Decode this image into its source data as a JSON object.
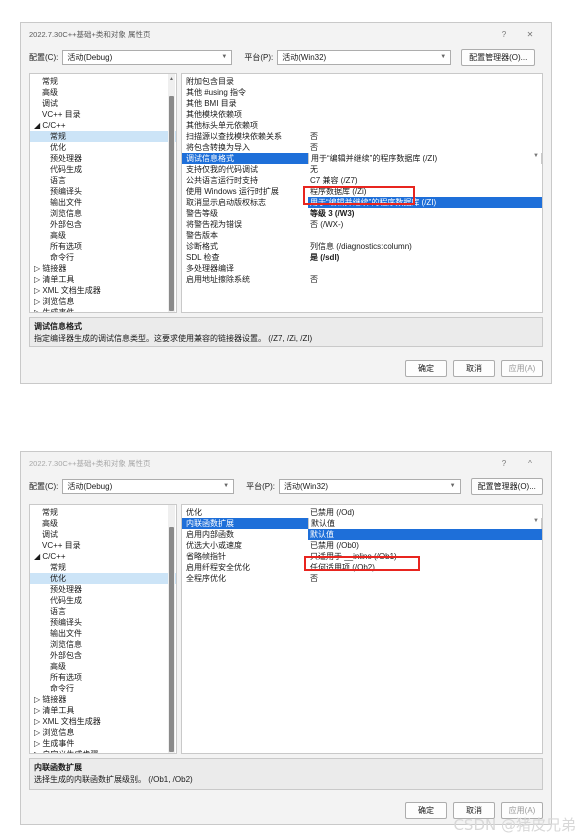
{
  "dialog1": {
    "title": "2022.7.30C++基础+类和对象 属性页",
    "help_glyph": "?",
    "close_glyph": "✕",
    "config_label": "配置(C):",
    "config_value": "活动(Debug)",
    "platform_label": "平台(P):",
    "platform_value": "活动(Win32)",
    "config_manager": "配置管理器(O)...",
    "tree": [
      {
        "label": "常规",
        "indent": 1
      },
      {
        "label": "高级",
        "indent": 1
      },
      {
        "label": "调试",
        "indent": 1
      },
      {
        "label": "VC++ 目录",
        "indent": 1
      },
      {
        "label": "◢ C/C++",
        "indent": 0
      },
      {
        "label": "常规",
        "indent": 2,
        "selected": true
      },
      {
        "label": "优化",
        "indent": 2
      },
      {
        "label": "预处理器",
        "indent": 2
      },
      {
        "label": "代码生成",
        "indent": 2
      },
      {
        "label": "语言",
        "indent": 2
      },
      {
        "label": "预编译头",
        "indent": 2
      },
      {
        "label": "输出文件",
        "indent": 2
      },
      {
        "label": "浏览信息",
        "indent": 2
      },
      {
        "label": "外部包含",
        "indent": 2
      },
      {
        "label": "高级",
        "indent": 2
      },
      {
        "label": "所有选项",
        "indent": 2
      },
      {
        "label": "命令行",
        "indent": 2
      },
      {
        "label": "▷ 链接器",
        "indent": 0
      },
      {
        "label": "▷ 清单工具",
        "indent": 0
      },
      {
        "label": "▷ XML 文档生成器",
        "indent": 0
      },
      {
        "label": "▷ 浏览信息",
        "indent": 0
      },
      {
        "label": "▷ 生成事件",
        "indent": 0
      },
      {
        "label": "▷ 自定义生成步骤",
        "indent": 0
      },
      {
        "label": "▷ 代码分析",
        "indent": 0
      }
    ],
    "props": [
      {
        "k": "附加包含目录",
        "v": ""
      },
      {
        "k": "其他 #using 指令",
        "v": ""
      },
      {
        "k": "其他 BMI 目录",
        "v": ""
      },
      {
        "k": "其他模块依赖项",
        "v": ""
      },
      {
        "k": "其他标头单元依赖项",
        "v": ""
      },
      {
        "k": "扫描源以查找模块依赖关系",
        "v": "否"
      },
      {
        "k": "将包含转换为导入",
        "v": "否"
      },
      {
        "k": "调试信息格式",
        "v": "用于“编辑并继续”的程序数据库 (/ZI)",
        "selected": true
      },
      {
        "k": "支持仅我的代码调试",
        "v": "无"
      },
      {
        "k": "公共语言运行时支持",
        "v": "C7 兼容 (/Z7)"
      },
      {
        "k": "使用 Windows 运行时扩展",
        "v": "程序数据库 (/Zi)"
      },
      {
        "k": "取消显示启动版权标志",
        "v": "用于“编辑并继续”的程序数据库 (/ZI)",
        "hi": true
      },
      {
        "k": "警告等级",
        "v": "等级 3 (/W3)",
        "bold": true
      },
      {
        "k": "将警告视为错误",
        "v": "否 (/WX-)"
      },
      {
        "k": "警告版本",
        "v": ""
      },
      {
        "k": "诊断格式",
        "v": "列信息 (/diagnostics:column)"
      },
      {
        "k": "SDL 检查",
        "v": "是 (/sdl)",
        "bold": true
      },
      {
        "k": "多处理器编译",
        "v": ""
      },
      {
        "k": "启用地址擦除系统",
        "v": "否"
      }
    ],
    "desc_title": "调试信息格式",
    "desc_text": "指定编译器生成的调试信息类型。这要求使用兼容的链接器设置。  (/Z7, /Zi, /ZI)",
    "ok": "确定",
    "cancel": "取消",
    "apply": "应用(A)"
  },
  "dialog2": {
    "title": "2022.7.30C++基础+类和对象 属性页",
    "help_glyph": "?",
    "close_glyph": "^",
    "config_label": "配置(C):",
    "config_value": "活动(Debug)",
    "platform_label": "平台(P):",
    "platform_value": "活动(Win32)",
    "config_manager": "配置管理器(O)...",
    "tree": [
      {
        "label": "常规",
        "indent": 1
      },
      {
        "label": "高级",
        "indent": 1
      },
      {
        "label": "调试",
        "indent": 1
      },
      {
        "label": "VC++ 目录",
        "indent": 1
      },
      {
        "label": "◢ C/C++",
        "indent": 0
      },
      {
        "label": "常规",
        "indent": 2
      },
      {
        "label": "优化",
        "indent": 2,
        "selected": true
      },
      {
        "label": "预处理器",
        "indent": 2
      },
      {
        "label": "代码生成",
        "indent": 2
      },
      {
        "label": "语言",
        "indent": 2
      },
      {
        "label": "预编译头",
        "indent": 2
      },
      {
        "label": "输出文件",
        "indent": 2
      },
      {
        "label": "浏览信息",
        "indent": 2
      },
      {
        "label": "外部包含",
        "indent": 2
      },
      {
        "label": "高级",
        "indent": 2
      },
      {
        "label": "所有选项",
        "indent": 2
      },
      {
        "label": "命令行",
        "indent": 2
      },
      {
        "label": "▷ 链接器",
        "indent": 0
      },
      {
        "label": "▷ 清单工具",
        "indent": 0
      },
      {
        "label": "▷ XML 文档生成器",
        "indent": 0
      },
      {
        "label": "▷ 浏览信息",
        "indent": 0
      },
      {
        "label": "▷ 生成事件",
        "indent": 0
      },
      {
        "label": "▷ 自定义生成步骤",
        "indent": 0
      },
      {
        "label": "▷ 代码分析",
        "indent": 0
      }
    ],
    "props": [
      {
        "k": "优化",
        "v": "已禁用 (/Od)"
      },
      {
        "k": "内联函数扩展",
        "v": "默认值",
        "selected": true
      },
      {
        "k": "启用内部函数",
        "v": "默认值",
        "hi": true
      },
      {
        "k": "优选大小或速度",
        "v": "已禁用 (/Ob0)"
      },
      {
        "k": "省略帧指针",
        "v": "只适用于 __inline (/Ob1)"
      },
      {
        "k": "启用纤程安全优化",
        "v": "任何适用项 (/Ob2)"
      },
      {
        "k": "全程序优化",
        "v": "否"
      }
    ],
    "desc_title": "内联函数扩展",
    "desc_text": "选择生成的内联函数扩展级别。   (/Ob1, /Ob2)",
    "ok": "确定",
    "cancel": "取消",
    "apply": "应用(A)"
  },
  "watermark": "CSDN @猪皮兄弟"
}
